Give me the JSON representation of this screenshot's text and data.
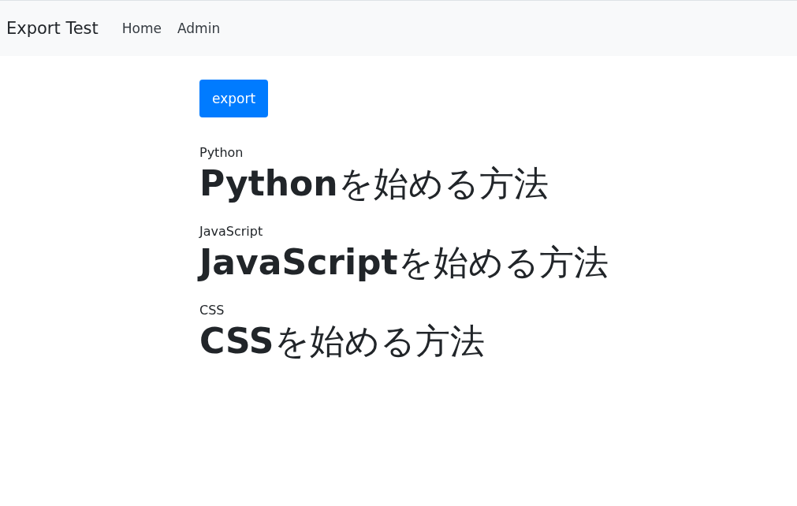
{
  "navbar": {
    "brand": "Export Test",
    "links": [
      {
        "label": "Home"
      },
      {
        "label": "Admin"
      }
    ]
  },
  "export_button": "export",
  "articles": [
    {
      "category": "Python",
      "title": "**Python**を始める方法"
    },
    {
      "category": "JavaScript",
      "title": "**JavaScript**を始める方法"
    },
    {
      "category": "CSS",
      "title": "**CSS**を始める方法"
    }
  ]
}
